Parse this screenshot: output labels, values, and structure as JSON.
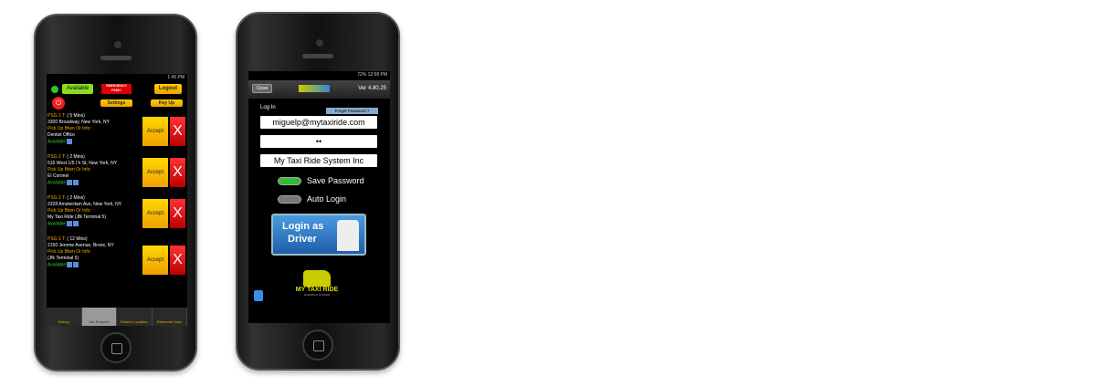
{
  "phone1": {
    "status_time": "1:45 PM",
    "available_label": "Available",
    "emergency_label": "EMERGENCY PANIC",
    "logout_label": "Logout",
    "settings_label": "Settings",
    "keyup_label": "Key Up",
    "jobs": [
      {
        "psg": "PSG:1",
        "t": "T:",
        "eta": "( 5 Mins)",
        "address": "3300 Broadway, New York, NY",
        "pickup": "Pick Up Btwn Or Info:",
        "info": "Dentist Office",
        "status": "Available"
      },
      {
        "psg": "PSG:1",
        "t": "T:",
        "eta": "( 2 Mins)",
        "address": "516 West 1/5 I h St, New York, NY",
        "pickup": "Pick Up Btwn Or Info:",
        "info": "El Coronel",
        "status": "Available"
      },
      {
        "psg": "PSG:1",
        "t": "T:",
        "eta": "( 2 Mins)",
        "address": "2328 Amsterdam Ave, New York, NY",
        "pickup": "Pick Up Btwn Or Info:",
        "info": "My Taxi Ride (Jfk Terminal 5)",
        "status": "Available"
      },
      {
        "psg": "PSG:1",
        "t": "T:",
        "eta": "( 12 Mins)",
        "address": "2150 Jerome Avenue, Bronx, NY",
        "pickup": "Pick Up Btwn Or Info:",
        "info": " (Jfk Terminal 5)",
        "status": "Available"
      }
    ],
    "accept_label": "Accept",
    "reject_label": "X",
    "nav": [
      "History",
      "Job Request",
      "Driver's Location",
      "Reserved Jobs"
    ]
  },
  "phone2": {
    "status_text": "72%",
    "status_time": "12:58 PM",
    "close_label": "Close",
    "version": "Ver 4.80.25",
    "login_heading": "Log In",
    "forgot_label": "Forget Password ?",
    "email": "miguelp@mytaxiride.com",
    "password": "••",
    "company": "My Taxi Ride System Inc",
    "save_password_label": "Save Password",
    "save_password_on": true,
    "auto_login_label": "Auto Login",
    "auto_login_on": false,
    "login_button_line1": "Login as",
    "login_button_line2": "Driver",
    "logo_text": "MY TAXI RIDE",
    "logo_sub": "DISPATCH SYSTEM"
  }
}
